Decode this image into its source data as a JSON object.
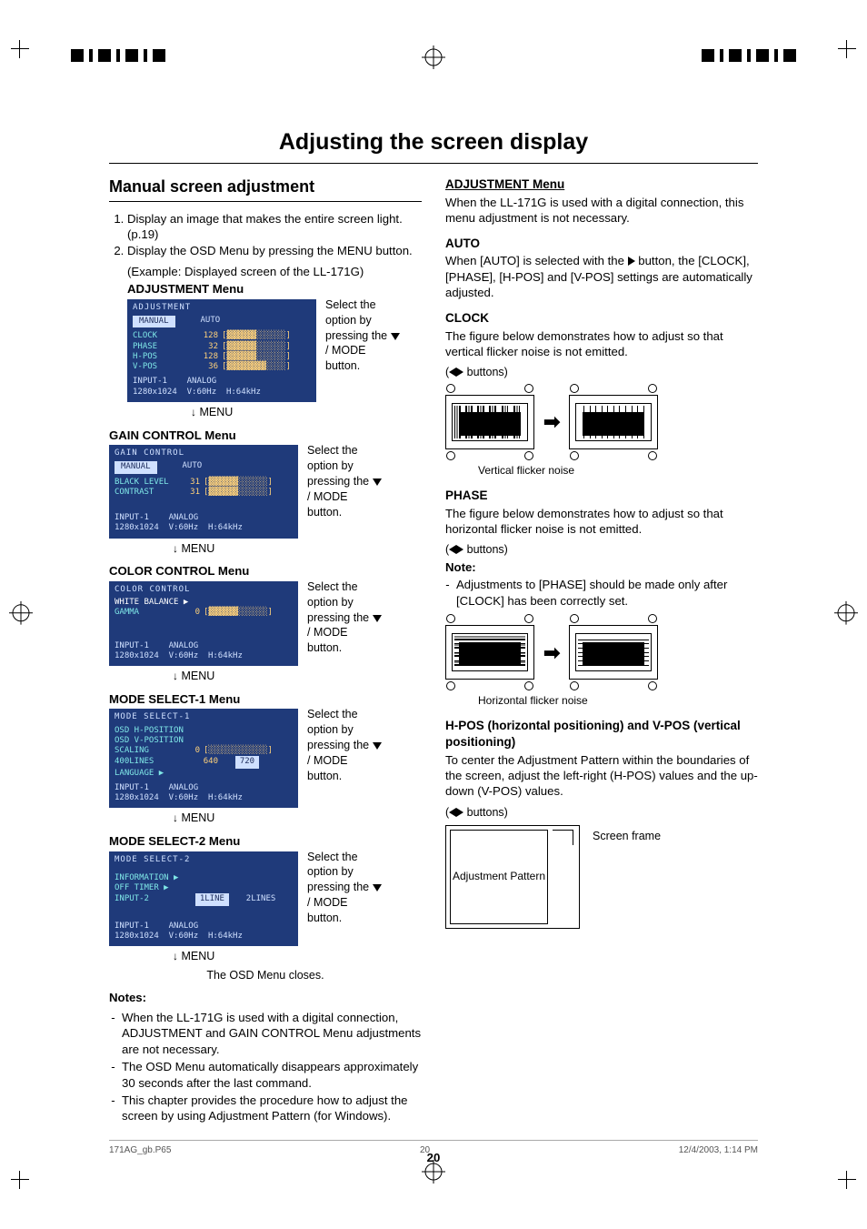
{
  "doc": {
    "title": "Adjusting the screen display",
    "page_number": "20",
    "footer_file": "171AG_gb.P65",
    "footer_page": "20",
    "footer_date": "12/4/2003, 1:14 PM"
  },
  "left": {
    "heading": "Manual screen adjustment",
    "steps": [
      "Display an image that makes the entire screen light. (p.19)",
      "Display the OSD Menu by pressing the MENU button."
    ],
    "example": "(Example: Displayed screen of the LL-171G)",
    "side_text": "Select the option by pressing the ",
    "side_text_tail": " / MODE button.",
    "menu_footer": "MENU",
    "close_text": "The OSD Menu closes.",
    "menus": [
      {
        "heading": "ADJUSTMENT Menu",
        "osd": {
          "title": "ADJUSTMENT",
          "tabs": [
            "MANUAL",
            "AUTO"
          ],
          "rows": [
            {
              "label": "CLOCK",
              "value": "128"
            },
            {
              "label": "PHASE",
              "value": "32"
            },
            {
              "label": "H-POS",
              "value": "128"
            },
            {
              "label": "V-POS",
              "value": "36"
            }
          ],
          "footer": "INPUT-1    ANALOG\n1280x1024  V:60Hz  H:64kHz"
        }
      },
      {
        "heading": "GAIN CONTROL Menu",
        "osd": {
          "title": "GAIN CONTROL",
          "tabs": [
            "MANUAL",
            "AUTO"
          ],
          "rows": [
            {
              "label": "BLACK LEVEL",
              "value": "31"
            },
            {
              "label": "CONTRAST",
              "value": "31"
            }
          ],
          "footer": "INPUT-1    ANALOG\n1280x1024  V:60Hz  H:64kHz"
        }
      },
      {
        "heading": "COLOR CONTROL Menu",
        "osd": {
          "title": "COLOR CONTROL",
          "rows_simple": [
            {
              "label": "WHITE BALANCE ▶",
              "class": "wb"
            },
            {
              "label": "GAMMA",
              "value": "0"
            }
          ],
          "footer": "INPUT-1    ANALOG\n1280x1024  V:60Hz  H:64kHz"
        }
      },
      {
        "heading": "MODE SELECT-1 Menu",
        "osd": {
          "title": "MODE SELECT-1",
          "rows_mode1": [
            {
              "label": "OSD H-POSITION"
            },
            {
              "label": "OSD V-POSITION"
            },
            {
              "label": "SCALING",
              "value": "0"
            },
            {
              "label": "400LINES",
              "val2": "640",
              "val3": "720"
            },
            {
              "label": "LANGUAGE ▶"
            }
          ],
          "footer": "INPUT-1    ANALOG\n1280x1024  V:60Hz  H:64kHz"
        }
      },
      {
        "heading": "MODE SELECT-2 Menu",
        "osd": {
          "title": "MODE SELECT-2",
          "rows_mode2": [
            {
              "label": "INFORMATION ▶"
            },
            {
              "label": "OFF TIMER ▶"
            },
            {
              "label": "INPUT-2",
              "val2": "1LINE",
              "val3": "2LINES"
            }
          ],
          "footer": "INPUT-1    ANALOG\n1280x1024  V:60Hz  H:64kHz"
        }
      }
    ],
    "notes_heading": "Notes:",
    "notes": [
      "When the LL-171G is used with a digital connection, ADJUSTMENT and GAIN CONTROL Menu adjustments are not necessary.",
      "The OSD Menu automatically disappears approximately 30 seconds after the last command.",
      "This chapter provides the procedure how to adjust the screen by using Adjustment Pattern (for Windows)."
    ]
  },
  "right": {
    "h_adjustment": "ADJUSTMENT Menu",
    "p_adjustment": "When the LL-171G is used with a digital connection, this menu adjustment is not necessary.",
    "h_auto": "AUTO",
    "p_auto_a": "When [AUTO] is selected with the ",
    "p_auto_b": " button, the [CLOCK], [PHASE], [H-POS] and [V-POS] settings are automatically adjusted.",
    "h_clock": "CLOCK",
    "p_clock": "The figure below demonstrates how to adjust so that vertical flicker noise is not emitted.",
    "lr_buttons": " buttons)",
    "cap_vert": "Vertical flicker noise",
    "h_phase": "PHASE",
    "p_phase": "The figure below demonstrates how to adjust so that horizontal flicker noise is not emitted.",
    "note_label": "Note:",
    "note_phase": "Adjustments to [PHASE] should be made only after [CLOCK] has been correctly set.",
    "cap_horiz": "Horizontal flicker noise",
    "h_hpos": "H-POS (horizontal positioning) and V-POS (vertical positioning)",
    "p_hpos": "To center the Adjustment Pattern within the boundaries of the screen, adjust the left-right (H-POS) values and the up-down (V-POS) values.",
    "frame_label": "Screen frame",
    "adj_pattern": "Adjustment Pattern"
  }
}
